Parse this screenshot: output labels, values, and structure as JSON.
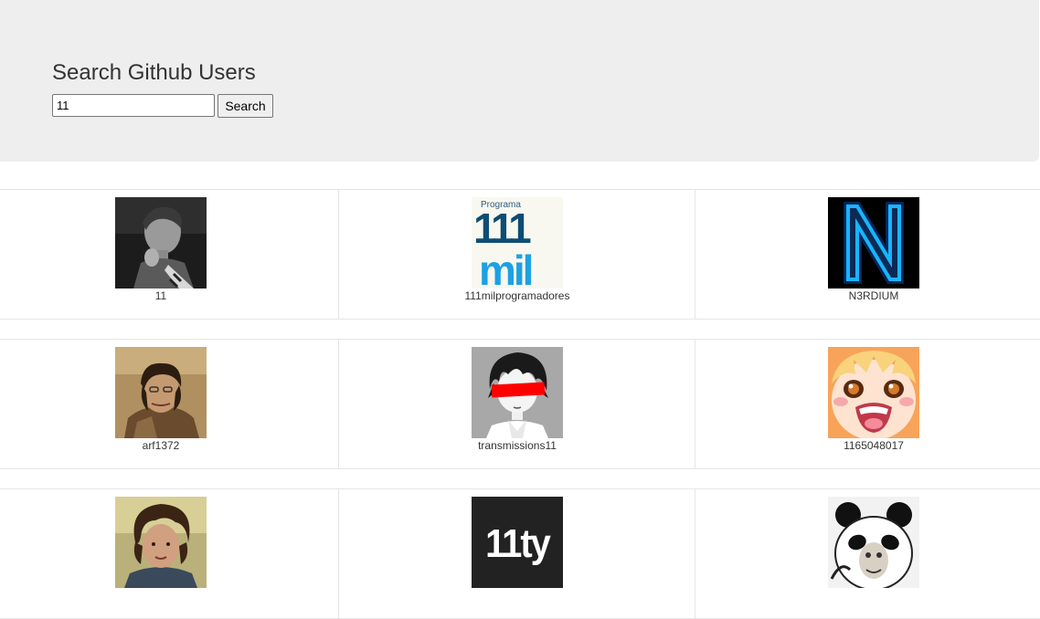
{
  "header": {
    "title": "Search Github Users",
    "search_value": "11",
    "search_button_label": "Search"
  },
  "users": [
    {
      "login": "11",
      "avatar": "photo-man-bw-icon"
    },
    {
      "login": "111milprogramadores",
      "avatar": "programa-111mil-logo-icon"
    },
    {
      "login": "N3RDIUM",
      "avatar": "neon-n-icon"
    },
    {
      "login": "arf1372",
      "avatar": "photo-young-man-icon"
    },
    {
      "login": "transmissions11",
      "avatar": "anime-boy-red-bar-icon"
    },
    {
      "login": "1165048017",
      "avatar": "anime-girl-crying-icon"
    },
    {
      "login": "",
      "avatar": "photo-curly-hair-man-icon"
    },
    {
      "login": "",
      "avatar": "11ty-logo-icon"
    },
    {
      "login": "",
      "avatar": "panda-meme-icon"
    }
  ],
  "logos": {
    "programa_small": "Programa",
    "programa_number": "111",
    "programa_word": "mil",
    "neon_letter": "N",
    "eleventy": "11ty"
  }
}
